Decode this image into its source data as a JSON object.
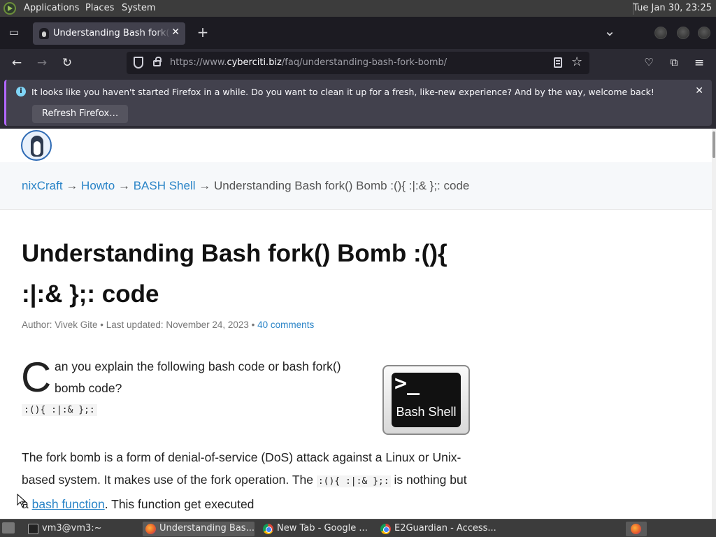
{
  "topbar": {
    "menus": [
      "Applications",
      "Places",
      "System"
    ],
    "clock": "Tue Jan 30, 23:25"
  },
  "browser": {
    "tab_title": "Understanding Bash fork() B",
    "new_tab": "+",
    "list_tabs": "⌄",
    "url_prefix": "https://www.",
    "url_host": "cyberciti.biz",
    "url_path": "/faq/understanding-bash-fork-bomb/",
    "notification": {
      "message": "It looks like you haven't started Firefox in a while. Do you want to clean it up for a fresh, like-new experience? And by the way, welcome back!",
      "button": "Refresh Firefox…"
    }
  },
  "page": {
    "breadcrumb": [
      "nixCraft",
      "Howto",
      "BASH Shell"
    ],
    "breadcrumb_sep": "→",
    "breadcrumb_current": "Understanding Bash fork() Bomb :(){ :|:& };: code",
    "title": "Understanding Bash fork() Bomb :(){ :|:& };: code",
    "meta_author": "Author: Vivek Gite • Last updated: November 24, 2023 • ",
    "meta_comments": "40 comments",
    "dropcap": "C",
    "intro": "an you explain the following bash code or bash fork() bomb code?",
    "code": ":(){ :|:& };:",
    "image_prompt": ">_",
    "image_label": "Bash Shell",
    "para_a": "The fork bomb is a form of denial-of-service (DoS) attack against a Linux or Unix-based system. It makes use of the fork operation. The ",
    "para_code": ":(){ :|:& };:",
    "para_b": " is nothing but a ",
    "para_link": "bash function",
    "para_c": ". This function get executed"
  },
  "taskbar": {
    "tasks": [
      "vm3@vm3:~",
      "Understanding Bas...",
      "New Tab - Google ...",
      "E2Guardian - Access..."
    ]
  }
}
